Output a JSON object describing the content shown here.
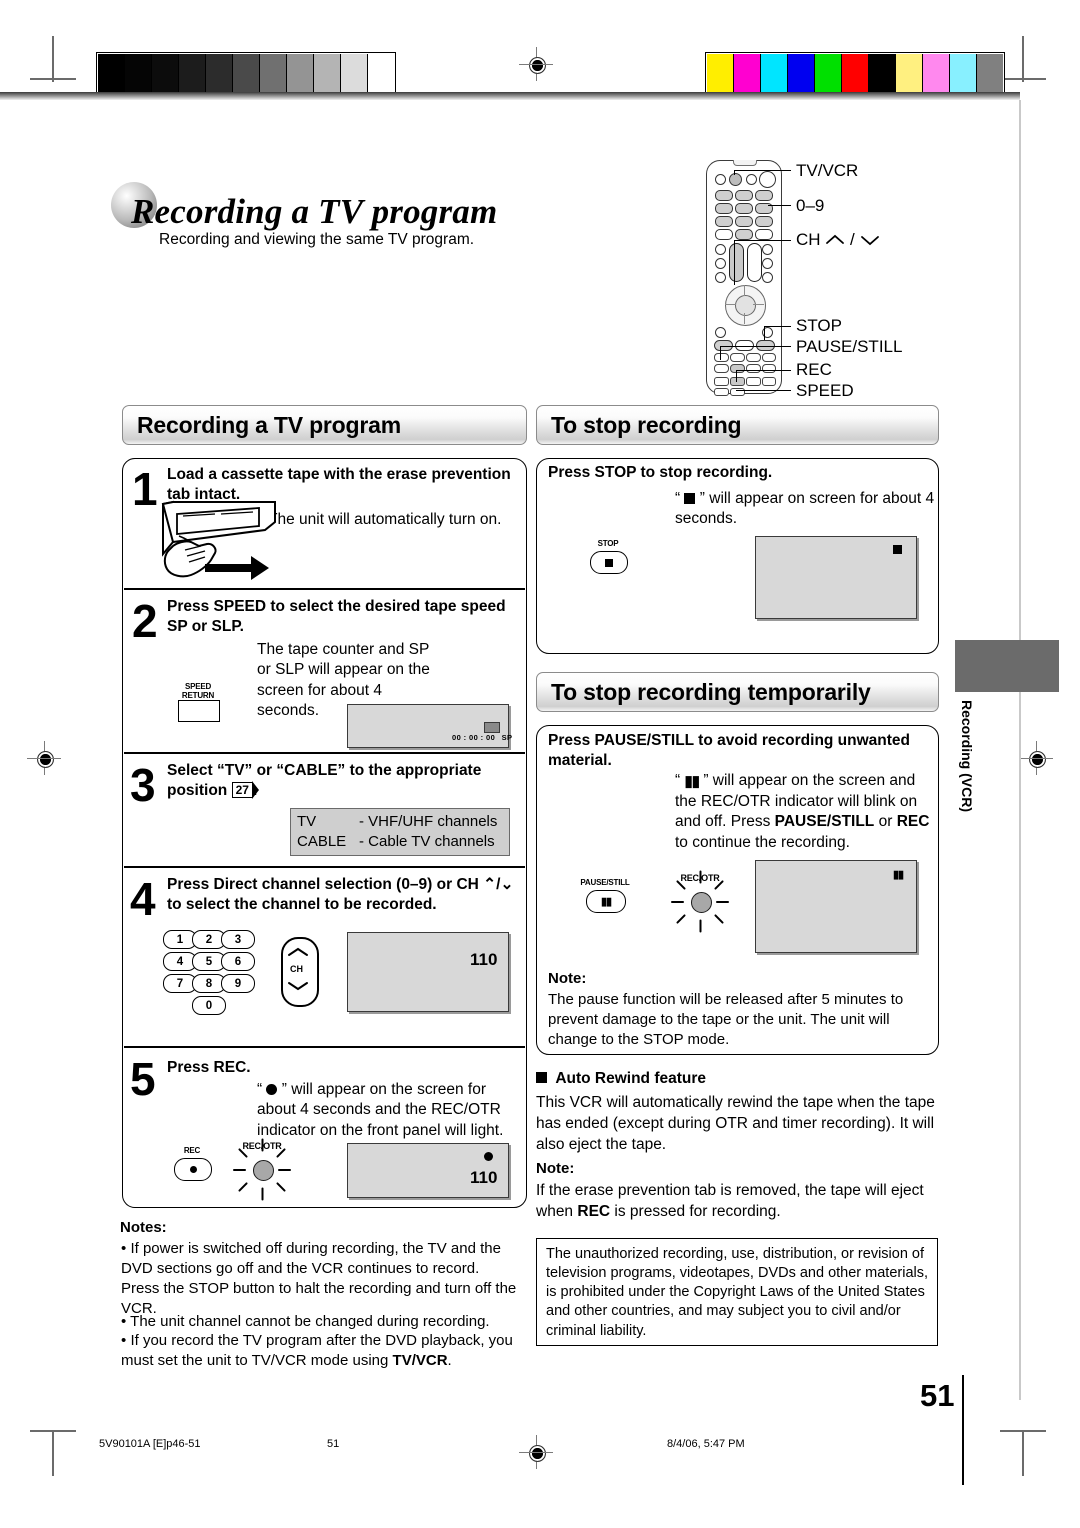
{
  "page": {
    "number": "51",
    "side_tab": "Recording (VCR)"
  },
  "header": {
    "title": "Recording a TV program",
    "subtitle": "Recording and viewing the same TV program."
  },
  "remote": {
    "callouts": [
      "TV/VCR",
      "0–9",
      "CH ⌃ / ⌄",
      "STOP",
      "PAUSE/STILL",
      "REC",
      "SPEED"
    ],
    "ch_label_prefix": "CH",
    "ch_up_glyph": "⌃",
    "ch_sep": "/",
    "ch_down_glyph": "⌄"
  },
  "left_column": {
    "section_title": "Recording a TV program",
    "steps": [
      {
        "num": "1",
        "title": "Load a cassette tape with the erase prevention tab intact.",
        "body": "The unit will automatically turn on.",
        "illustration": "cassette-insert-hand"
      },
      {
        "num": "2",
        "title": "Press SPEED to select the desired tape speed SP or SLP.",
        "body": "The tape counter and SP or SLP will appear on the screen for about 4 seconds.",
        "button_label_line1": "SPEED",
        "button_label_line2": "RETURN",
        "screen_counter": "00 : 00 : 00",
        "screen_speed": "SP"
      },
      {
        "num": "3",
        "title_part1": "Select “TV” or “CABLE” to the appropriate position ",
        "title_ref": "27",
        "title_part2": ".",
        "table": [
          {
            "mode": "TV",
            "dash": "-",
            "desc": "VHF/UHF channels"
          },
          {
            "mode": "CABLE",
            "dash": "-",
            "desc": "Cable TV channels"
          }
        ]
      },
      {
        "num": "4",
        "title": "Press Direct channel selection (0–9) or CH ⌃/⌄ to select the channel to be recorded.",
        "numpad": [
          "1",
          "2",
          "3",
          "4",
          "5",
          "6",
          "7",
          "8",
          "9",
          "0"
        ],
        "ch_text": "CH",
        "screen_channel": "110"
      },
      {
        "num": "5",
        "title": "Press REC.",
        "body_pre": "“",
        "body_post": "” will appear on the screen for about 4 seconds and the REC/OTR indicator on the front panel will light.",
        "rec_button_label": "REC",
        "indicator_label": "REC/OTR",
        "screen_channel": "110"
      }
    ],
    "notes_title": "Notes:",
    "notes": [
      "If power is switched off during recording, the TV and the DVD sections go off and the VCR continues to record. Press the STOP button to halt the recording and turn off the VCR.",
      "The unit channel cannot be changed during recording.",
      "If you record the TV program after the DVD playback, you must set the unit to TV/VCR mode using TV/VCR."
    ],
    "note3_bold_tail": "TV/VCR",
    "note3_prefix": "If you record the TV program after the DVD playback, you must set the unit to TV/VCR mode using ",
    "note3_suffix": "."
  },
  "right_column": {
    "stop_section": {
      "title": "To stop recording",
      "heading": "Press STOP to stop recording.",
      "body_pre": "“",
      "body_post": "” will appear on screen for about 4 seconds.",
      "button_label": "STOP"
    },
    "pause_section": {
      "title": "To stop recording temporarily",
      "heading": "Press PAUSE/STILL to avoid recording unwanted material.",
      "body_pre": "“",
      "body_mid": "” will appear on the screen and the REC/OTR indicator will blink on and off. Press ",
      "body_bold1": "PAUSE/STILL",
      "body_mid2": " or ",
      "body_bold2": "REC",
      "body_end": " to continue the recording.",
      "button_label": "PAUSE/STILL",
      "indicator_label": "REC/OTR",
      "note_title": "Note:",
      "note_body": "The pause function will be released after 5 minutes to prevent damage to the tape or the unit. The unit will change to the STOP mode."
    },
    "auto_rewind": {
      "title": "Auto Rewind feature",
      "body": "This VCR will automatically rewind the tape when the tape has ended (except during OTR and timer recording). It will also eject the tape.",
      "note_title": "Note:",
      "note_prefix": "If the erase prevention tab is removed, the tape will eject when ",
      "note_bold": "REC",
      "note_suffix": " is pressed for recording."
    },
    "copyright_notice": "The unauthorized recording, use, distribution, or revision of television programs, videotapes, DVDs and other materials, is prohibited under the Copyright Laws of the United States and other countries, and may subject you to civil and/or criminal liability."
  },
  "footer": {
    "left": "5V90101A [E]p46-51",
    "center": "51",
    "right": "8/4/06, 5:47 PM"
  },
  "color_bars": {
    "grayscale": [
      "#000000",
      "#050505",
      "#0c0c0c",
      "#1c1c1c",
      "#2c2c2c",
      "#4a4a4a",
      "#707070",
      "#949494",
      "#b4b4b4",
      "#dcdcdc",
      "#ffffff"
    ],
    "colors": [
      "#ffee00",
      "#ff00d0",
      "#00e5ff",
      "#0000f0",
      "#00e000",
      "#ff0000",
      "#000000",
      "#fff080",
      "#ff88ee",
      "#88f0ff",
      "#808080"
    ]
  }
}
